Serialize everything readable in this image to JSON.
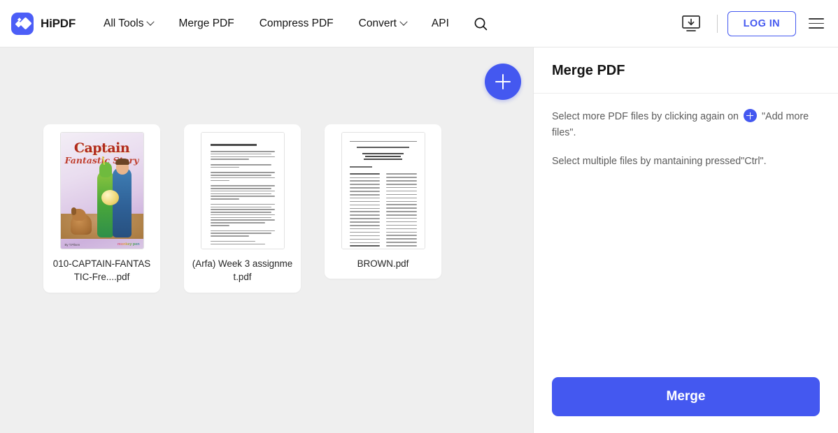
{
  "header": {
    "brand_name": "HiPDF",
    "logo_icon": "hipdf-diamond-logo",
    "nav_items": [
      {
        "label": "All Tools",
        "has_caret": true
      },
      {
        "label": "Merge PDF",
        "has_caret": false
      },
      {
        "label": "Compress PDF",
        "has_caret": false
      },
      {
        "label": "Convert",
        "has_caret": true
      },
      {
        "label": "API",
        "has_caret": false
      }
    ],
    "search_icon": "search-icon",
    "desktop_icon": "desktop-download-icon",
    "login_label": "LOG IN",
    "menu_icon": "hamburger-menu-icon"
  },
  "workspace": {
    "add_files_icon": "plus-icon",
    "files": [
      {
        "name": "010-CAPTAIN-FANTASTIC-Fre....pdf",
        "thumb_type": "comic-cover",
        "thumb_text": {
          "title_line1": "Captain",
          "title_line2": "Fantastic Story",
          "credit": "By T.Pilsen",
          "publisher": "monkey pen"
        }
      },
      {
        "name": "(Arfa) Week 3 assignmet.pdf",
        "thumb_type": "text-document"
      },
      {
        "name": "BROWN.pdf",
        "thumb_type": "index-document"
      }
    ]
  },
  "panel": {
    "title": "Merge PDF",
    "hint_before_icon": "Select more PDF files by clicking again on",
    "hint_icon": "plus-icon",
    "hint_after_icon": "\"Add more files\".",
    "hint_second": "Select multiple files by mantaining pressed\"Ctrl\".",
    "merge_label": "Merge"
  },
  "colors": {
    "accent": "#4458f0",
    "workspace_bg": "#efefef",
    "panel_bg": "#ffffff",
    "text_primary": "#141414",
    "text_secondary": "#5c5c5c"
  }
}
